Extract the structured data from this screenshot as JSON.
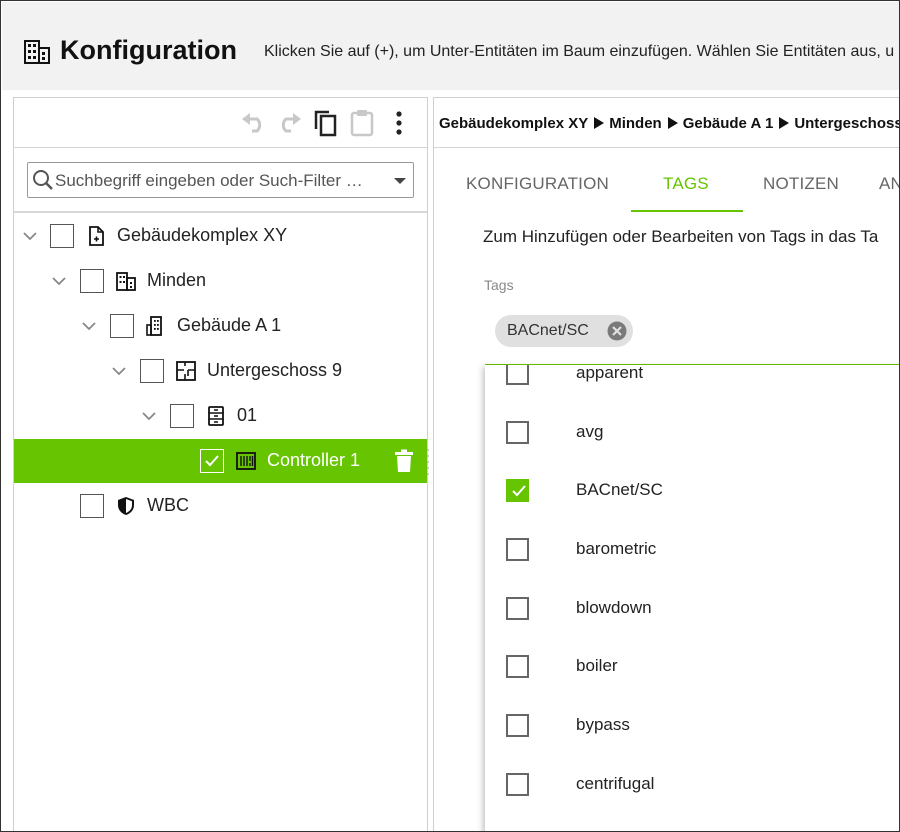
{
  "header": {
    "title": "Konfiguration",
    "hint": "Klicken Sie auf (+), um Unter-Entitäten im Baum einzufügen. Wählen Sie Entitäten aus, u"
  },
  "toolbar": {
    "undo_icon": "undo-icon",
    "redo_icon": "redo-icon",
    "copy_icon": "copy-icon",
    "paste_icon": "paste-icon",
    "more_icon": "more-vertical-icon"
  },
  "search": {
    "placeholder": "Suchbegriff eingeben oder Such-Filter …"
  },
  "tree": {
    "items": [
      {
        "label": "Gebäudekomplex XY",
        "icon": "site-document-icon",
        "checked": false
      },
      {
        "label": "Minden",
        "icon": "city-building-icon",
        "checked": false
      },
      {
        "label": "Gebäude A 1",
        "icon": "building-icon",
        "checked": false
      },
      {
        "label": "Untergeschoss 9",
        "icon": "floor-plan-icon",
        "checked": false
      },
      {
        "label": "01",
        "icon": "room-cabinet-icon",
        "checked": false
      },
      {
        "label": "Controller 1",
        "icon": "controller-icon",
        "checked": true,
        "selected": true
      },
      {
        "label": "WBC",
        "icon": "shield-icon",
        "checked": false
      }
    ]
  },
  "breadcrumb": [
    "Gebäudekomplex XY",
    "Minden",
    "Gebäude A 1",
    "Untergeschoss"
  ],
  "tabs": [
    {
      "label": "KONFIGURATION",
      "active": false
    },
    {
      "label": "TAGS",
      "active": true
    },
    {
      "label": "NOTIZEN",
      "active": false
    },
    {
      "label": "AN",
      "active": false
    }
  ],
  "tags_panel": {
    "description": "Zum Hinzufügen oder Bearbeiten von Tags in das Ta",
    "label": "Tags",
    "selected_chip": "BACnet/SC"
  },
  "tag_options": [
    {
      "label": "apparent",
      "checked": false
    },
    {
      "label": "avg",
      "checked": false
    },
    {
      "label": "BACnet/SC",
      "checked": true
    },
    {
      "label": "barometric",
      "checked": false
    },
    {
      "label": "blowdown",
      "checked": false
    },
    {
      "label": "boiler",
      "checked": false
    },
    {
      "label": "bypass",
      "checked": false
    },
    {
      "label": "centrifugal",
      "checked": false
    }
  ],
  "colors": {
    "accent": "#66c400",
    "header_bg": "#f2f2f2"
  }
}
